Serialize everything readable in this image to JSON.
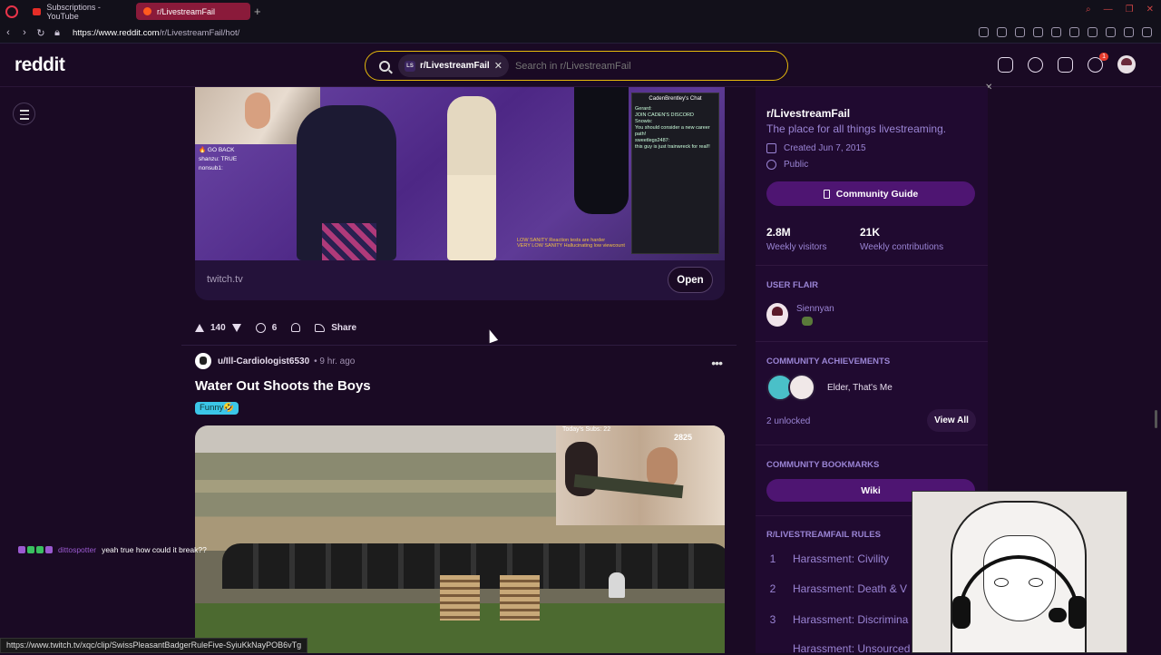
{
  "browser": {
    "tabs": [
      {
        "label": "Subscriptions - YouTube"
      },
      {
        "label": "r/LivestreamFail"
      }
    ],
    "url": {
      "base": "https://www.reddit.com",
      "path": "/r/LivestreamFail/hot/"
    }
  },
  "header": {
    "logo": "reddit",
    "search_chip": "r/LivestreamFail",
    "search_chip_icon": "LS",
    "search_placeholder": "Search in r/LivestreamFail",
    "notifications_count": "1"
  },
  "post1": {
    "link_domain": "twitch.tv",
    "open_label": "Open",
    "votes": "140",
    "comments": "6",
    "share_label": "Share",
    "video": {
      "chat_lines": [
        "🔥 GO BACK",
        "shanzu: TRUE",
        "nonsub1: "
      ],
      "vchat_title": "CadenBrentley's Chat",
      "vchat_lines": [
        "Gerard:",
        "JOIN CADEN'S DISCORD",
        "Snowis:",
        "You should consider a new career path!",
        "sweetlegs2487:",
        "this guy is just trainwreck for real!!"
      ],
      "stats": [
        "LOW SANITY   Reaction tests are harder",
        "VERY LOW SANITY   Hallucinating low viewcount"
      ]
    }
  },
  "post2": {
    "user": "u/Ill-Cardiologist6530",
    "time": "• 9 hr. ago",
    "title": "Water Out Shoots the Boys",
    "flair": "Funny🤣",
    "video": {
      "subs_text": "Today's Subs: 22",
      "count": "2825"
    }
  },
  "sidebar": {
    "title": "r/LivestreamFail",
    "description": "The place for all things livestreaming.",
    "created": "Created Jun 7, 2015",
    "visibility": "Public",
    "guide_label": "Community Guide",
    "visitors_value": "2.8M",
    "visitors_label": "Weekly visitors",
    "contributions_value": "21K",
    "contributions_label": "Weekly contributions",
    "user_flair_heading": "USER FLAIR",
    "flair_name": "Siennyan",
    "achievements_heading": "COMMUNITY ACHIEVEMENTS",
    "achievement_name": "Elder, That's Me",
    "unlocked": "2 unlocked",
    "view_all": "View All",
    "bookmarks_heading": "COMMUNITY BOOKMARKS",
    "wiki_label": "Wiki",
    "rules_heading": "R/LIVESTREAMFAIL RULES",
    "rules": [
      {
        "num": "1",
        "text": "Harassment: Civility"
      },
      {
        "num": "2",
        "text": "Harassment: Death & V"
      },
      {
        "num": "3",
        "text": "Harassment: Discrimina"
      },
      {
        "num": "",
        "text": "Harassment: Unsourced"
      }
    ]
  },
  "stream_chat": {
    "user": "dittospotter",
    "message": "yeah true how could it break??"
  },
  "status_bar": "https://www.twitch.tv/xqc/clip/SwissPleasantBadgerRuleFive-SyiuKkNayPOB6vTg",
  "colors": {
    "accent": "#4e1572",
    "background": "#1a0a24",
    "search_border": "#e5b90b",
    "link": "#9a84d4"
  }
}
